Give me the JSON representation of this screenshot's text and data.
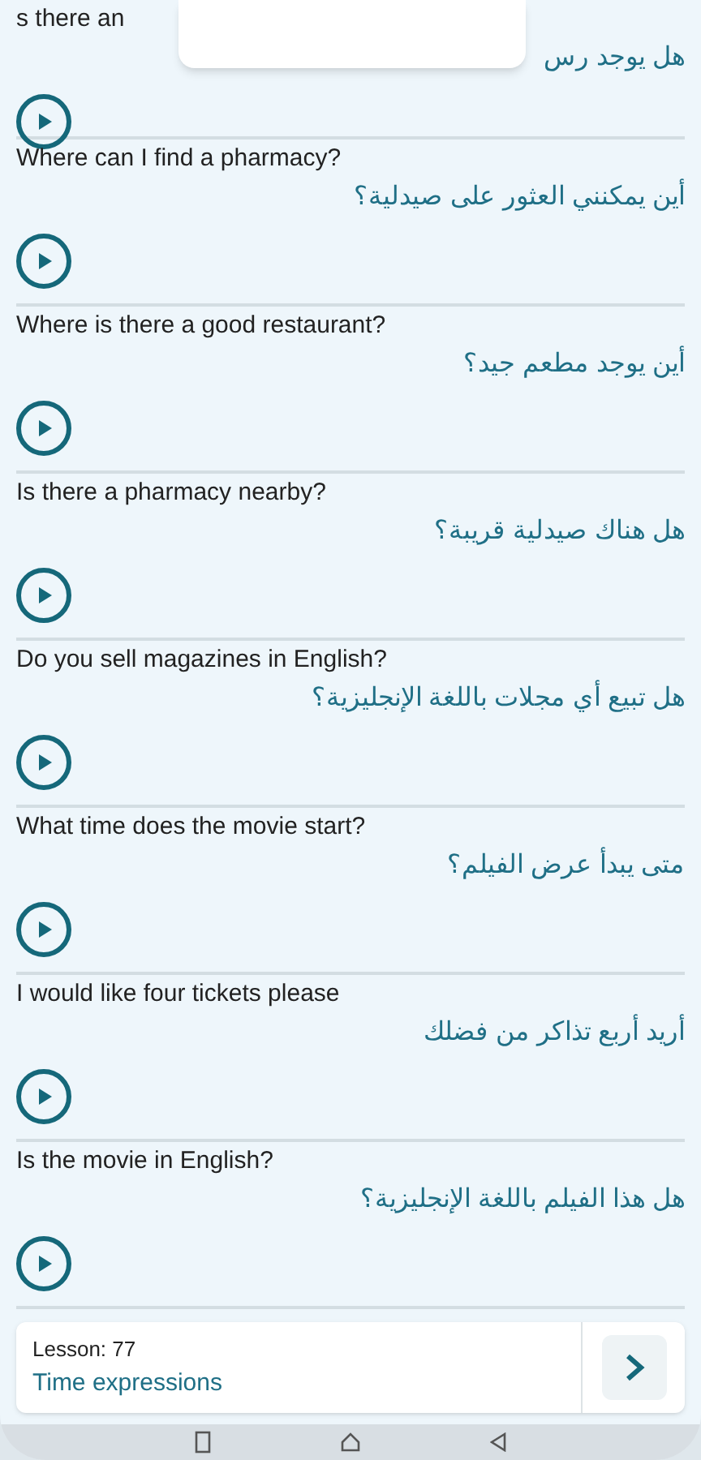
{
  "phrases": [
    {
      "english": "s there an",
      "arabic": "هل يوجد رس"
    },
    {
      "english": "Where can I find a pharmacy?",
      "arabic": "أين يمكنني العثور على صيدلية؟"
    },
    {
      "english": "Where is there a good restaurant?",
      "arabic": "أين يوجد مطعم جيد؟"
    },
    {
      "english": "Is there a pharmacy nearby?",
      "arabic": "هل هناك صيدلية قريبة؟"
    },
    {
      "english": "Do you sell magazines in English?",
      "arabic": "هل تبيع أي مجلات باللغة الإنجليزية؟"
    },
    {
      "english": "What time does the movie start?",
      "arabic": "متى يبدأ عرض الفيلم؟"
    },
    {
      "english": "I would like four tickets please",
      "arabic": "أريد أربع تذاكر من فضلك"
    },
    {
      "english": "Is the movie in English?",
      "arabic": "هل هذا الفيلم باللغة الإنجليزية؟"
    }
  ],
  "next_lesson": {
    "lesson": "Lesson: 77",
    "title": "Time expressions"
  }
}
